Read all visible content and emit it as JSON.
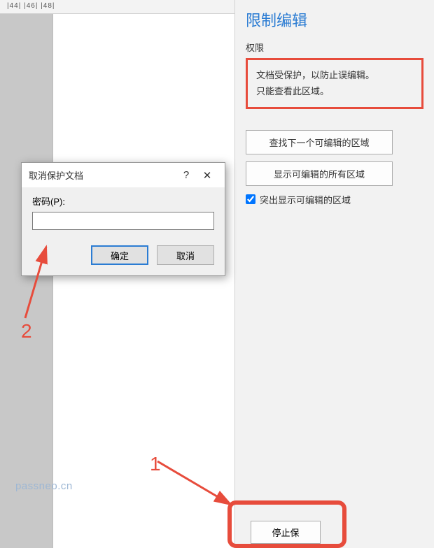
{
  "ruler": {
    "marks": " |44|   |46|   |48|"
  },
  "panel": {
    "title": "限制编辑",
    "section": "权限",
    "info_line1": "文档受保护，以防止误编辑。",
    "info_line2": "只能查看此区域。",
    "btn_find_next": "查找下一个可编辑的区域",
    "btn_show_all": "显示可编辑的所有区域",
    "checkbox_label": "突出显示可编辑的区域",
    "checkbox_checked": true,
    "stop_button": "停止保"
  },
  "dialog": {
    "title": "取消保护文档",
    "help_icon": "?",
    "close_icon": "✕",
    "password_label": "密码(P):",
    "password_value": "",
    "ok": "确定",
    "cancel": "取消"
  },
  "annotations": {
    "n1": "1",
    "n2": "2"
  },
  "watermark": "passneo.cn"
}
